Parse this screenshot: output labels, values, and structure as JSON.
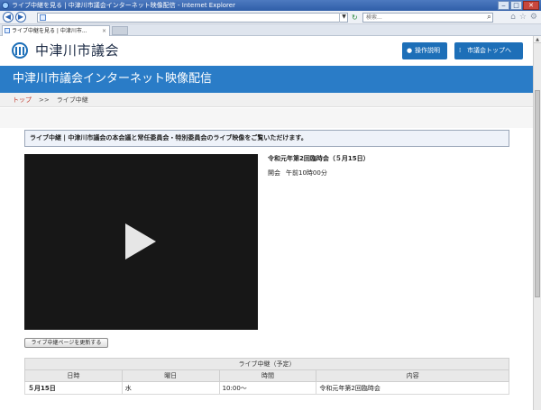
{
  "window": {
    "title": "ライブ中継を見る | 中津川市議会インターネット映像配信 - Internet Explorer",
    "controls": {
      "minimize": "‒",
      "maximize": "□",
      "close": "✕"
    }
  },
  "browser": {
    "url": "",
    "search_placeholder": "検索...",
    "tab_label": "ライブ中継を見る | 中津川市...",
    "tab_close": "×"
  },
  "header": {
    "site_name": "中津川市議会",
    "manual_button": "操作説明",
    "council_top_button": "市議会トップへ"
  },
  "banner": {
    "title": "中津川市議会インターネット映像配信"
  },
  "breadcrumb": {
    "home": "トップ",
    "separator": ">>",
    "current": "ライブ中継"
  },
  "live": {
    "notice": "ライブ中継 | 中津川市議会の本会議と常任委員会・特別委員会のライブ映像をご覧いただけます。",
    "meeting_title": "令和元年第2回臨時会（５月15日）",
    "meeting_time_label": "開会",
    "meeting_time_value": "午前10時00分",
    "refresh_button": "ライブ中継ページを更新する"
  },
  "schedule": {
    "caption": "ライブ中継（予定）",
    "headers": [
      "日時",
      "曜日",
      "時間",
      "内容"
    ],
    "rows": [
      [
        "５月15日",
        "水",
        "10:00～",
        "令和元年第2回臨時会"
      ]
    ]
  }
}
